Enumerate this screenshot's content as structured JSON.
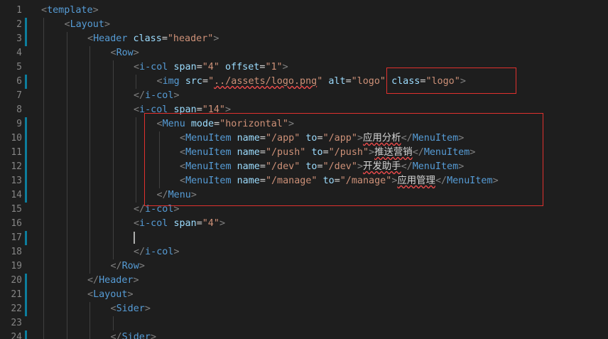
{
  "editor": {
    "colors": {
      "background": "#1e1e1e",
      "line_number": "#858585",
      "tag": "#569cd6",
      "attribute": "#9cdcfe",
      "string": "#ce9178",
      "punctuation": "#808080",
      "text": "#d4d4d4",
      "git_modified_marker": "#0c7d9d",
      "annotation_box": "#e0312e"
    },
    "lines": [
      {
        "n": "1",
        "tokens": [
          [
            "p",
            "<"
          ],
          [
            "t",
            "template"
          ],
          [
            "p",
            ">"
          ]
        ]
      },
      {
        "n": "2",
        "tokens": [
          [
            "p",
            "<"
          ],
          [
            "t",
            "Layout"
          ],
          [
            "p",
            ">"
          ]
        ]
      },
      {
        "n": "3",
        "tokens": [
          [
            "p",
            "<"
          ],
          [
            "t",
            "Header"
          ],
          [
            "x",
            " "
          ],
          [
            "a",
            "class"
          ],
          [
            "x",
            "="
          ],
          [
            "s",
            "\"header\""
          ],
          [
            "p",
            ">"
          ]
        ]
      },
      {
        "n": "4",
        "tokens": [
          [
            "p",
            "<"
          ],
          [
            "t",
            "Row"
          ],
          [
            "p",
            ">"
          ]
        ]
      },
      {
        "n": "5",
        "tokens": [
          [
            "p",
            "<"
          ],
          [
            "t",
            "i-col"
          ],
          [
            "x",
            " "
          ],
          [
            "a",
            "span"
          ],
          [
            "x",
            "="
          ],
          [
            "s",
            "\"4\""
          ],
          [
            "x",
            " "
          ],
          [
            "a",
            "offset"
          ],
          [
            "x",
            "="
          ],
          [
            "s",
            "\"1\""
          ],
          [
            "p",
            ">"
          ]
        ]
      },
      {
        "n": "6",
        "tokens": [
          [
            "p",
            "<"
          ],
          [
            "t",
            "img"
          ],
          [
            "x",
            " "
          ],
          [
            "a",
            "src"
          ],
          [
            "x",
            "="
          ],
          [
            "s",
            "\""
          ],
          [
            "su",
            "../assets/logo.png"
          ],
          [
            "s",
            "\""
          ],
          [
            "x",
            " "
          ],
          [
            "a",
            "alt"
          ],
          [
            "x",
            "="
          ],
          [
            "s",
            "\"logo\""
          ],
          [
            "x",
            " "
          ],
          [
            "a",
            "class"
          ],
          [
            "x",
            "="
          ],
          [
            "s",
            "\"logo\""
          ],
          [
            "p",
            ">"
          ]
        ]
      },
      {
        "n": "7",
        "tokens": [
          [
            "p",
            "</"
          ],
          [
            "t",
            "i-col"
          ],
          [
            "p",
            ">"
          ]
        ]
      },
      {
        "n": "8",
        "tokens": [
          [
            "p",
            "<"
          ],
          [
            "t",
            "i-col"
          ],
          [
            "x",
            " "
          ],
          [
            "a",
            "span"
          ],
          [
            "x",
            "="
          ],
          [
            "s",
            "\"14\""
          ],
          [
            "p",
            ">"
          ]
        ]
      },
      {
        "n": "9",
        "tokens": [
          [
            "p",
            "<"
          ],
          [
            "t",
            "Menu"
          ],
          [
            "x",
            " "
          ],
          [
            "a",
            "mode"
          ],
          [
            "x",
            "="
          ],
          [
            "s",
            "\"horizontal\""
          ],
          [
            "p",
            ">"
          ]
        ]
      },
      {
        "n": "10",
        "tokens": [
          [
            "p",
            "<"
          ],
          [
            "t",
            "MenuItem"
          ],
          [
            "x",
            " "
          ],
          [
            "a",
            "name"
          ],
          [
            "x",
            "="
          ],
          [
            "s",
            "\"/app\""
          ],
          [
            "x",
            " "
          ],
          [
            "a",
            "to"
          ],
          [
            "x",
            "="
          ],
          [
            "s",
            "\"/app\""
          ],
          [
            "p",
            ">"
          ],
          [
            "xw",
            "应用分析"
          ],
          [
            "p",
            "</"
          ],
          [
            "t",
            "MenuItem"
          ],
          [
            "p",
            ">"
          ]
        ]
      },
      {
        "n": "11",
        "tokens": [
          [
            "p",
            "<"
          ],
          [
            "t",
            "MenuItem"
          ],
          [
            "x",
            " "
          ],
          [
            "a",
            "name"
          ],
          [
            "x",
            "="
          ],
          [
            "s",
            "\"/push\""
          ],
          [
            "x",
            " "
          ],
          [
            "a",
            "to"
          ],
          [
            "x",
            "="
          ],
          [
            "s",
            "\"/push\""
          ],
          [
            "p",
            ">"
          ],
          [
            "xw",
            "推送营销"
          ],
          [
            "p",
            "</"
          ],
          [
            "t",
            "MenuItem"
          ],
          [
            "p",
            ">"
          ]
        ]
      },
      {
        "n": "12",
        "tokens": [
          [
            "p",
            "<"
          ],
          [
            "t",
            "MenuItem"
          ],
          [
            "x",
            " "
          ],
          [
            "a",
            "name"
          ],
          [
            "x",
            "="
          ],
          [
            "s",
            "\"/dev\""
          ],
          [
            "x",
            " "
          ],
          [
            "a",
            "to"
          ],
          [
            "x",
            "="
          ],
          [
            "s",
            "\"/dev\""
          ],
          [
            "p",
            ">"
          ],
          [
            "xw",
            "开发助手"
          ],
          [
            "p",
            "</"
          ],
          [
            "t",
            "MenuItem"
          ],
          [
            "p",
            ">"
          ]
        ]
      },
      {
        "n": "13",
        "tokens": [
          [
            "p",
            "<"
          ],
          [
            "t",
            "MenuItem"
          ],
          [
            "x",
            " "
          ],
          [
            "a",
            "name"
          ],
          [
            "x",
            "="
          ],
          [
            "s",
            "\"/manage\""
          ],
          [
            "x",
            " "
          ],
          [
            "a",
            "to"
          ],
          [
            "x",
            "="
          ],
          [
            "s",
            "\"/manage\""
          ],
          [
            "p",
            ">"
          ],
          [
            "xw",
            "应用管理"
          ],
          [
            "p",
            "</"
          ],
          [
            "t",
            "MenuItem"
          ],
          [
            "p",
            ">"
          ]
        ]
      },
      {
        "n": "14",
        "tokens": [
          [
            "p",
            "</"
          ],
          [
            "t",
            "Menu"
          ],
          [
            "p",
            ">"
          ]
        ]
      },
      {
        "n": "15",
        "tokens": [
          [
            "p",
            "</"
          ],
          [
            "t",
            "i-col"
          ],
          [
            "p",
            ">"
          ]
        ]
      },
      {
        "n": "16",
        "tokens": [
          [
            "p",
            "<"
          ],
          [
            "t",
            "i-col"
          ],
          [
            "x",
            " "
          ],
          [
            "a",
            "span"
          ],
          [
            "x",
            "="
          ],
          [
            "s",
            "\"4\""
          ],
          [
            "p",
            ">"
          ]
        ]
      },
      {
        "n": "17",
        "tokens": []
      },
      {
        "n": "18",
        "tokens": [
          [
            "p",
            "</"
          ],
          [
            "t",
            "i-col"
          ],
          [
            "p",
            ">"
          ]
        ]
      },
      {
        "n": "19",
        "tokens": [
          [
            "p",
            "</"
          ],
          [
            "t",
            "Row"
          ],
          [
            "p",
            ">"
          ]
        ]
      },
      {
        "n": "20",
        "tokens": [
          [
            "p",
            "</"
          ],
          [
            "t",
            "Header"
          ],
          [
            "p",
            ">"
          ]
        ]
      },
      {
        "n": "21",
        "tokens": [
          [
            "p",
            "<"
          ],
          [
            "t",
            "Layout"
          ],
          [
            "p",
            ">"
          ]
        ]
      },
      {
        "n": "22",
        "tokens": [
          [
            "p",
            "<"
          ],
          [
            "t",
            "Sider"
          ],
          [
            "p",
            ">"
          ]
        ]
      },
      {
        "n": "23",
        "tokens": []
      },
      {
        "n": "24",
        "tokens": [
          [
            "p",
            "</"
          ],
          [
            "t",
            "Sider"
          ],
          [
            "p",
            ">"
          ]
        ]
      }
    ]
  }
}
